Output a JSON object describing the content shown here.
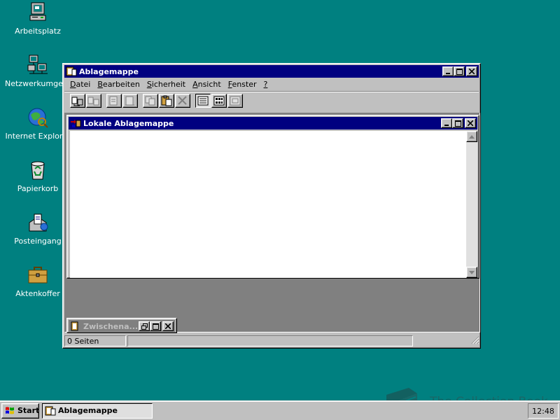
{
  "desktop": {
    "icons": [
      {
        "label": "Arbeitsplatz",
        "icon": "computer-icon"
      },
      {
        "label": "Netzwerkumgebung",
        "icon": "network-icon"
      },
      {
        "label": "Internet Explorer",
        "icon": "internet-explorer-icon"
      },
      {
        "label": "Papierkorb",
        "icon": "recycle-bin-icon"
      },
      {
        "label": "Posteingang",
        "icon": "inbox-icon"
      },
      {
        "label": "Aktenkoffer",
        "icon": "briefcase-icon"
      }
    ]
  },
  "main_window": {
    "title": "Ablagemappe",
    "menu": [
      {
        "accel": "D",
        "rest": "atei"
      },
      {
        "accel": "B",
        "rest": "earbeiten"
      },
      {
        "accel": "S",
        "rest": "icherheit"
      },
      {
        "accel": "A",
        "rest": "nsicht"
      },
      {
        "accel": "F",
        "rest": "enster"
      },
      {
        "accel": "?",
        "rest": ""
      }
    ],
    "child_window": {
      "title": "Lokale Ablagemappe"
    },
    "minimized_window": {
      "title": "Zwischena..."
    },
    "status": {
      "pages": "0 Seiten"
    }
  },
  "taskbar": {
    "start_label": "Start",
    "tasks": [
      {
        "label": "Ablagemappe"
      }
    ],
    "clock": "12:48"
  },
  "watermark": {
    "text": "The Collection Book"
  },
  "colors": {
    "desktop": "#008080",
    "titlebar_active": "#000080",
    "titlebar_inactive": "#808080",
    "face": "#c0c0c0"
  }
}
